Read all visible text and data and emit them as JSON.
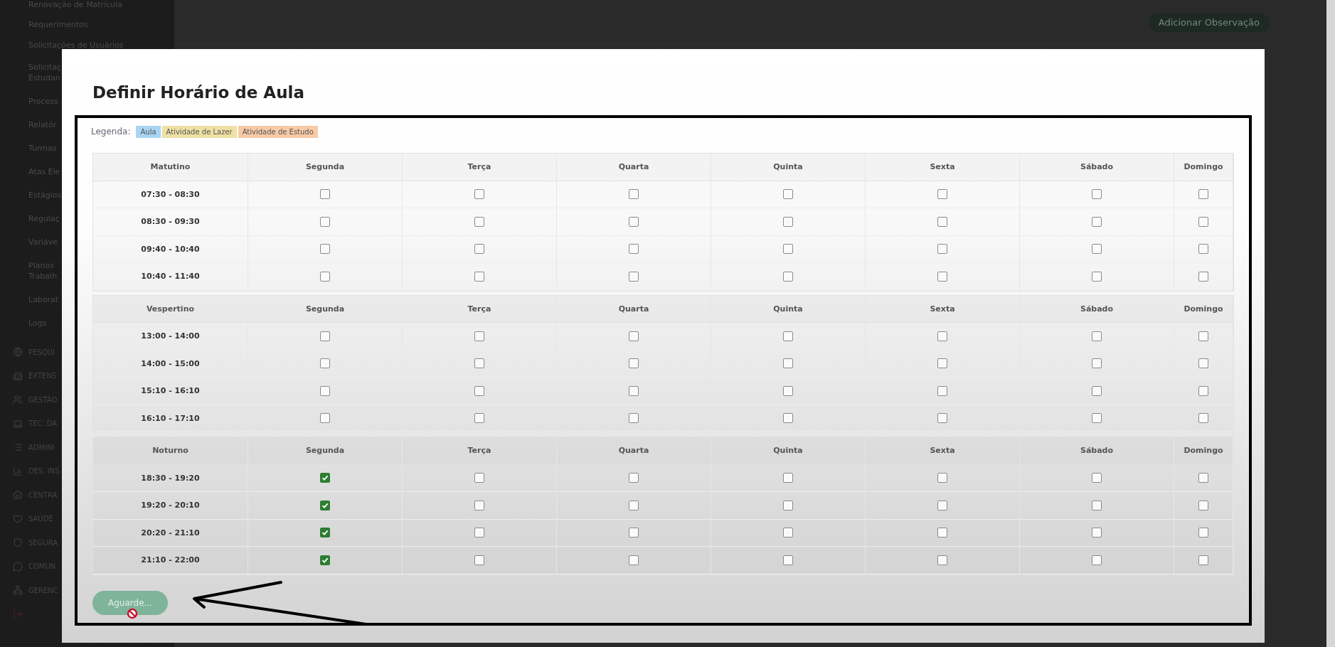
{
  "sidebar": {
    "links": [
      "Renovação de Matrícula",
      "Requerimentos",
      "Solicitações de Usuários",
      "Solicitaç\nEstudan",
      "Process",
      "Relatór",
      "Turmas",
      "Atas Ele",
      "Estágios",
      "Regulaç",
      "Variáve",
      "Planos\nTrabalh",
      "Laborat",
      "Logs"
    ],
    "sections": [
      "PESQUI",
      "EXTENS",
      "GESTÃO",
      "TEC. DA",
      "ADMINI",
      "DES. INS",
      "CENTRA",
      "SAÚDE",
      "SEGURA",
      "COMUN",
      "GERENC"
    ]
  },
  "background_button": "Adicionar Observação",
  "modal": {
    "title": "Definir Horário de Aula",
    "legend": {
      "label": "Legenda:",
      "items": [
        {
          "label": "Aula",
          "color": "#a9d4f2"
        },
        {
          "label": "Atividade de Lazer",
          "color": "#efe1a3"
        },
        {
          "label": "Atividade de Estudo",
          "color": "#f8caa6"
        }
      ]
    },
    "sections": [
      {
        "name": "Matutino",
        "days": [
          "Segunda",
          "Terça",
          "Quarta",
          "Quinta",
          "Sexta",
          "Sábado",
          "Domingo"
        ],
        "rows": [
          {
            "time": "07:30 - 08:30",
            "checked": [
              false,
              false,
              false,
              false,
              false,
              false,
              false
            ]
          },
          {
            "time": "08:30 - 09:30",
            "checked": [
              false,
              false,
              false,
              false,
              false,
              false,
              false
            ]
          },
          {
            "time": "09:40 - 10:40",
            "checked": [
              false,
              false,
              false,
              false,
              false,
              false,
              false
            ]
          },
          {
            "time": "10:40 - 11:40",
            "checked": [
              false,
              false,
              false,
              false,
              false,
              false,
              false
            ]
          }
        ]
      },
      {
        "name": "Vespertino",
        "days": [
          "Segunda",
          "Terça",
          "Quarta",
          "Quinta",
          "Sexta",
          "Sábado",
          "Domingo"
        ],
        "rows": [
          {
            "time": "13:00 - 14:00",
            "checked": [
              false,
              false,
              false,
              false,
              false,
              false,
              false
            ]
          },
          {
            "time": "14:00 - 15:00",
            "checked": [
              false,
              false,
              false,
              false,
              false,
              false,
              false
            ]
          },
          {
            "time": "15:10 - 16:10",
            "checked": [
              false,
              false,
              false,
              false,
              false,
              false,
              false
            ]
          },
          {
            "time": "16:10 - 17:10",
            "checked": [
              false,
              false,
              false,
              false,
              false,
              false,
              false
            ]
          }
        ]
      },
      {
        "name": "Noturno",
        "days": [
          "Segunda",
          "Terça",
          "Quarta",
          "Quinta",
          "Sexta",
          "Sábado",
          "Domingo"
        ],
        "rows": [
          {
            "time": "18:30 - 19:20",
            "checked": [
              true,
              false,
              false,
              false,
              false,
              false,
              false
            ]
          },
          {
            "time": "19:20 - 20:10",
            "checked": [
              true,
              false,
              false,
              false,
              false,
              false,
              false
            ]
          },
          {
            "time": "20:20 - 21:10",
            "checked": [
              true,
              false,
              false,
              false,
              false,
              false,
              false
            ]
          },
          {
            "time": "21:10 - 22:00",
            "checked": [
              true,
              false,
              false,
              false,
              false,
              false,
              false
            ]
          }
        ]
      }
    ],
    "submit": {
      "label": "Aguarde...",
      "disabled": true
    }
  }
}
